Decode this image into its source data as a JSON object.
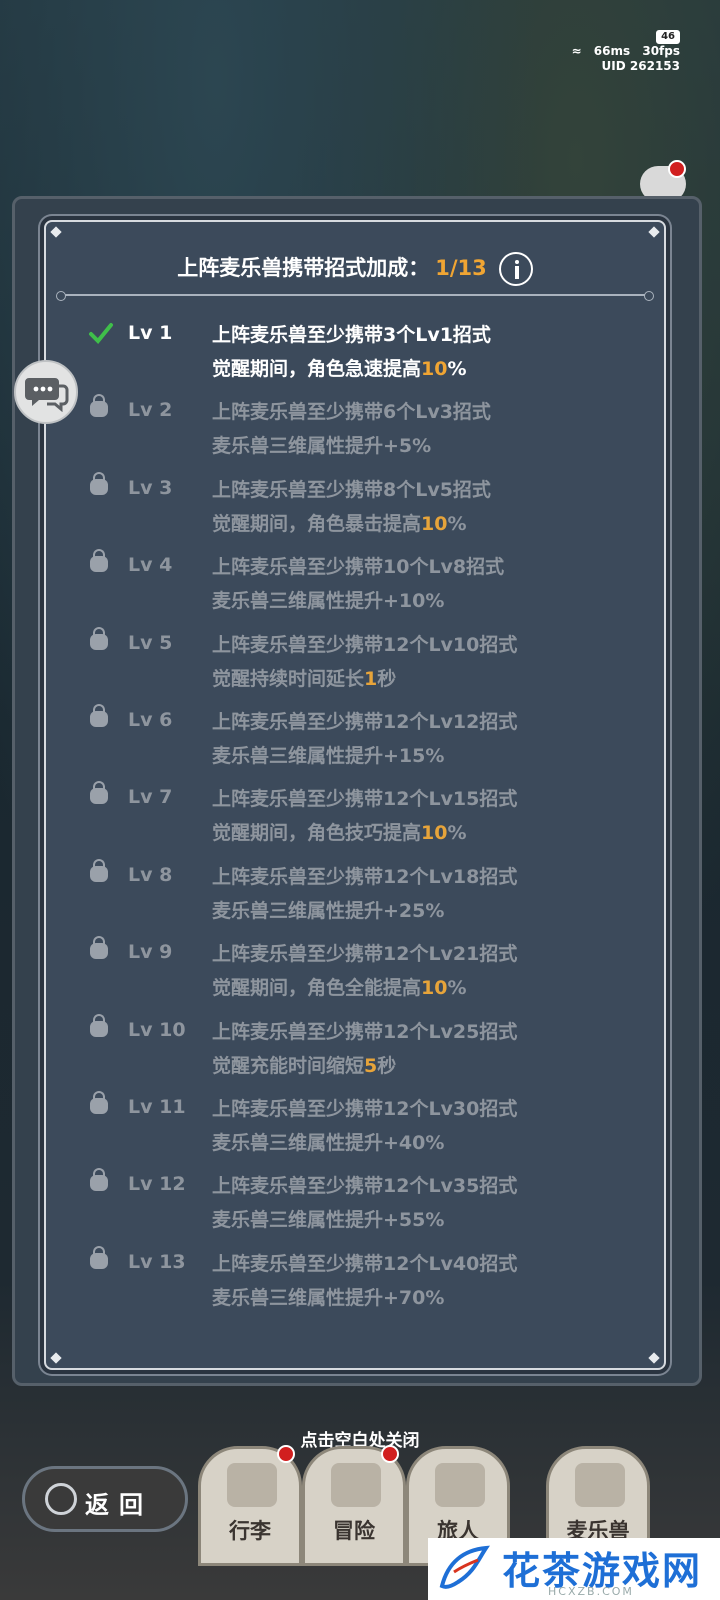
{
  "status": {
    "battery": "46",
    "ping": "66ms",
    "fps": "30fps",
    "uid": "UID 262153"
  },
  "panel": {
    "title": "上阵麦乐兽携带招式加成：",
    "count": "1/13",
    "levels": [
      {
        "lv": "Lv 1",
        "line1": "上阵麦乐兽至少携带3个Lv1招式",
        "line2_pre": "觉醒期间，角色急速提高",
        "line2_hl": "10",
        "line2_post": "%",
        "unlocked": true
      },
      {
        "lv": "Lv 2",
        "line1": "上阵麦乐兽至少携带6个Lv3招式",
        "line2_pre": "麦乐兽三维属性提升+5%",
        "line2_hl": "",
        "line2_post": ""
      },
      {
        "lv": "Lv 3",
        "line1": "上阵麦乐兽至少携带8个Lv5招式",
        "line2_pre": "觉醒期间，角色暴击提高",
        "line2_hl": "10",
        "line2_post": "%"
      },
      {
        "lv": "Lv 4",
        "line1": "上阵麦乐兽至少携带10个Lv8招式",
        "line2_pre": "麦乐兽三维属性提升+10%",
        "line2_hl": "",
        "line2_post": ""
      },
      {
        "lv": "Lv 5",
        "line1": "上阵麦乐兽至少携带12个Lv10招式",
        "line2_pre": "觉醒持续时间延长",
        "line2_hl": "1",
        "line2_post": "秒"
      },
      {
        "lv": "Lv 6",
        "line1": "上阵麦乐兽至少携带12个Lv12招式",
        "line2_pre": "麦乐兽三维属性提升+15%",
        "line2_hl": "",
        "line2_post": ""
      },
      {
        "lv": "Lv 7",
        "line1": "上阵麦乐兽至少携带12个Lv15招式",
        "line2_pre": "觉醒期间，角色技巧提高",
        "line2_hl": "10",
        "line2_post": "%"
      },
      {
        "lv": "Lv 8",
        "line1": "上阵麦乐兽至少携带12个Lv18招式",
        "line2_pre": "麦乐兽三维属性提升+25%",
        "line2_hl": "",
        "line2_post": ""
      },
      {
        "lv": "Lv 9",
        "line1": "上阵麦乐兽至少携带12个Lv21招式",
        "line2_pre": "觉醒期间，角色全能提高",
        "line2_hl": "10",
        "line2_post": "%"
      },
      {
        "lv": "Lv 10",
        "line1": "上阵麦乐兽至少携带12个Lv25招式",
        "line2_pre": "觉醒充能时间缩短",
        "line2_hl": "5",
        "line2_post": "秒"
      },
      {
        "lv": "Lv 11",
        "line1": "上阵麦乐兽至少携带12个Lv30招式",
        "line2_pre": "麦乐兽三维属性提升+40%",
        "line2_hl": "",
        "line2_post": ""
      },
      {
        "lv": "Lv 12",
        "line1": "上阵麦乐兽至少携带12个Lv35招式",
        "line2_pre": "麦乐兽三维属性提升+55%",
        "line2_hl": "",
        "line2_post": ""
      },
      {
        "lv": "Lv 13",
        "line1": "上阵麦乐兽至少携带12个Lv40招式",
        "line2_pre": "麦乐兽三维属性提升+70%",
        "line2_hl": "",
        "line2_post": ""
      }
    ]
  },
  "close_hint": "点击空白处关闭",
  "bottom_nav": {
    "back": "返回",
    "tabs": [
      "行李",
      "冒险",
      "旅人",
      "麦乐兽"
    ]
  },
  "watermark": {
    "title": "花茶游戏网",
    "sub": "HCXZB.COM"
  },
  "colors": {
    "highlight": "#f0a533",
    "panel_bg": "#3c4a5b",
    "check": "#3fbf4a"
  }
}
